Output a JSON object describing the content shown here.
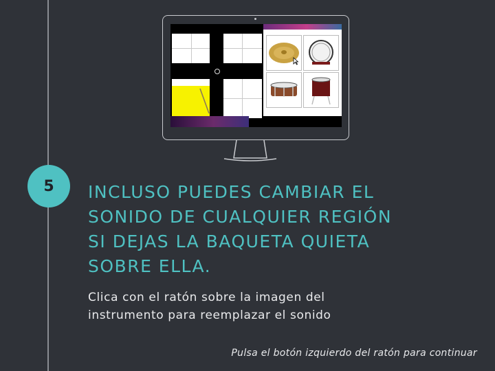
{
  "step": {
    "number": "5"
  },
  "heading": {
    "lines": [
      "INCLUSO PUEDES CAMBIAR EL",
      "SONIDO DE CUALQUIER REGIÓN",
      "SI DEJAS LA BAQUETA QUIETA",
      "SOBRE ELLA."
    ]
  },
  "body": {
    "lines": [
      "Clica con el ratón sobre la imagen del",
      "instrumento para reemplazar el sonido"
    ]
  },
  "footer": {
    "hint": "Pulsa el botón izquierdo del ratón para continuar"
  },
  "screen": {
    "highlight_color": "#f7f200",
    "accent_color": "#4fc1c2",
    "instruments": [
      "cymbal-icon",
      "bass-drum-icon",
      "snare-drum-icon",
      "floor-tom-icon"
    ]
  }
}
